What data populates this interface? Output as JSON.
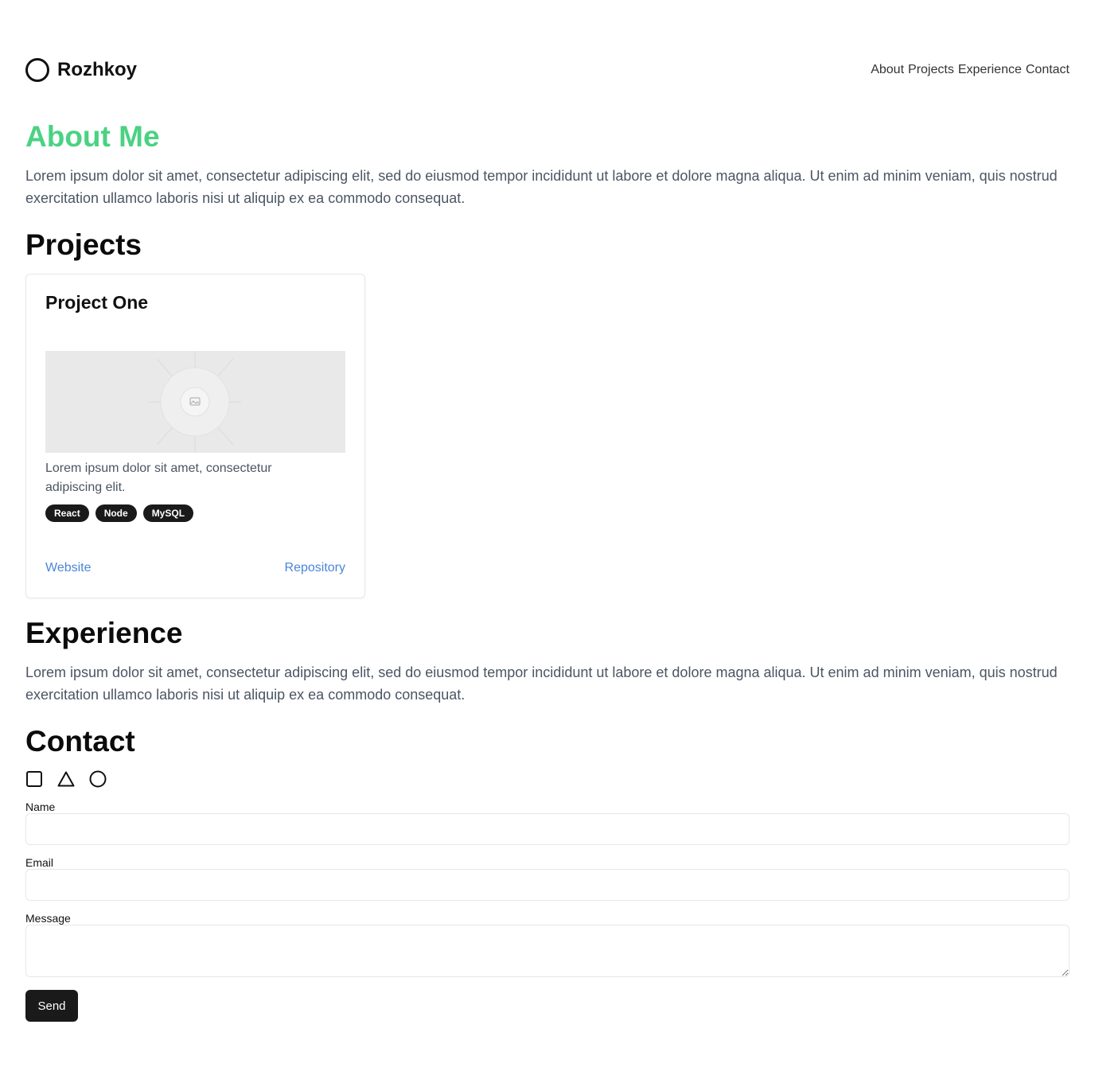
{
  "header": {
    "logo_text": "Rozhkoy",
    "nav": [
      "About",
      "Projects",
      "Experience",
      "Contact"
    ]
  },
  "about": {
    "title": "About Me",
    "text": "Lorem ipsum dolor sit amet, consectetur adipiscing elit, sed do eiusmod tempor incididunt ut labore et dolore magna aliqua. Ut enim ad minim veniam, quis nostrud exercitation ullamco laboris nisi ut aliquip ex ea commodo consequat."
  },
  "projects": {
    "title": "Projects",
    "items": [
      {
        "title": "Project One",
        "description": "Lorem ipsum dolor sit amet, consectetur adipiscing elit.",
        "tags": [
          "React",
          "Node",
          "MySQL"
        ],
        "website_label": "Website",
        "repository_label": "Repository"
      }
    ]
  },
  "experience": {
    "title": "Experience",
    "text": "Lorem ipsum dolor sit amet, consectetur adipiscing elit, sed do eiusmod tempor incididunt ut labore et dolore magna aliqua. Ut enim ad minim veniam, quis nostrud exercitation ullamco laboris nisi ut aliquip ex ea commodo consequat."
  },
  "contact": {
    "title": "Contact",
    "icons": [
      "square-icon",
      "triangle-icon",
      "circle-icon"
    ],
    "form": {
      "name_label": "Name",
      "name_value": "",
      "email_label": "Email",
      "email_value": "",
      "message_label": "Message",
      "message_value": "",
      "send_label": "Send"
    }
  },
  "colors": {
    "accent": "#4ad282",
    "link": "#4a86d8",
    "dark": "#1a1a1a"
  }
}
